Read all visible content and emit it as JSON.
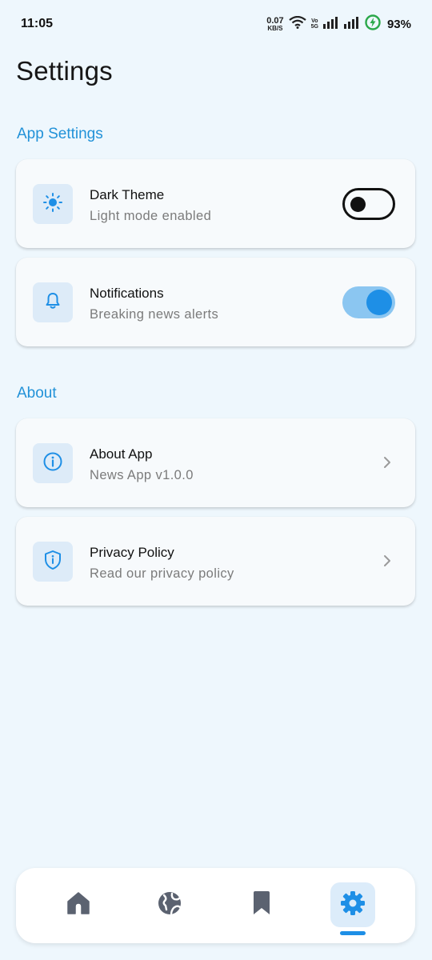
{
  "status_bar": {
    "time": "11:05",
    "net_speed_value": "0.07",
    "net_speed_unit": "KB/S",
    "volte_line1": "Vo",
    "volte_line2": "5G",
    "battery": "93%"
  },
  "page": {
    "title": "Settings"
  },
  "sections": {
    "app_settings": {
      "title": "App Settings",
      "items": [
        {
          "title": "Dark Theme",
          "subtitle": "Light mode enabled",
          "icon": "sun-icon",
          "control": "toggle",
          "enabled": false
        },
        {
          "title": "Notifications",
          "subtitle": "Breaking news alerts",
          "icon": "bell-icon",
          "control": "toggle",
          "enabled": true
        }
      ]
    },
    "about": {
      "title": "About",
      "items": [
        {
          "title": "About App",
          "subtitle": "News App v1.0.0",
          "icon": "info-icon",
          "control": "chevron"
        },
        {
          "title": "Privacy Policy",
          "subtitle": "Read our privacy policy",
          "icon": "shield-icon",
          "control": "chevron"
        }
      ]
    }
  },
  "bottom_nav": {
    "items": [
      {
        "icon": "home-icon",
        "active": false
      },
      {
        "icon": "globe-icon",
        "active": false
      },
      {
        "icon": "bookmark-icon",
        "active": false
      },
      {
        "icon": "gear-icon",
        "active": true
      }
    ]
  },
  "colors": {
    "background": "#EEF7FD",
    "accent": "#1E8FE6",
    "section_header": "#2292D8",
    "card": "#F7FAFC",
    "icon_tile": "#DDEBF8",
    "nav_inactive": "#5B6270"
  }
}
